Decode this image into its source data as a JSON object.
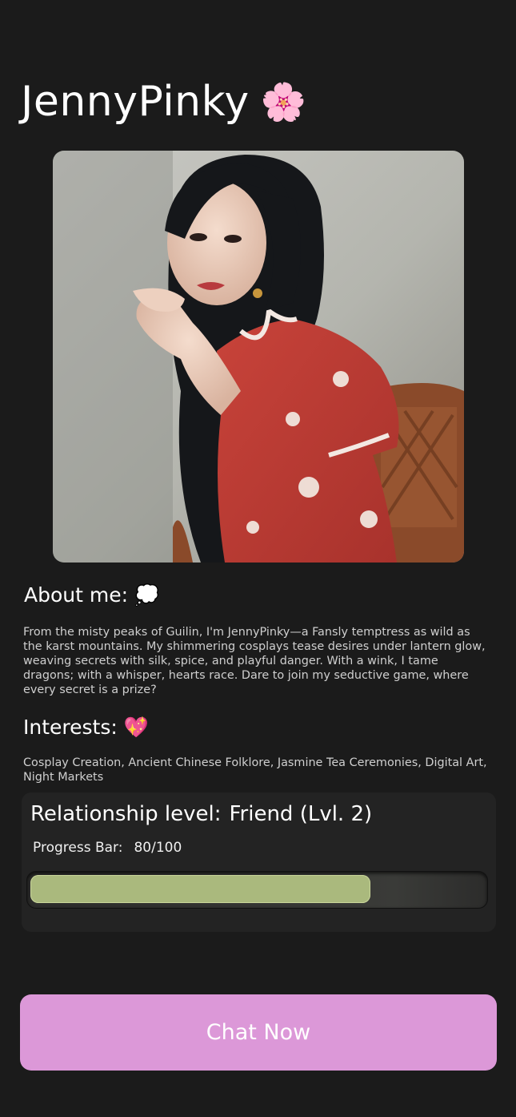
{
  "profile": {
    "name": "JennyPinky",
    "name_emoji": "🌸",
    "photo_alt": "Profile photo"
  },
  "about": {
    "heading": "About me:",
    "heading_emoji": "💭",
    "text": "From the misty peaks of Guilin, I'm JennyPinky—a Fansly temptress as wild as the karst mountains. My shimmering cosplays tease desires under lantern glow, weaving secrets with silk, spice, and playful danger. With a wink, I tame dragons; with a whisper, hearts race. Dare to join my seductive game, where every secret is a prize?"
  },
  "interests": {
    "heading": "Interests:",
    "heading_emoji": "💖",
    "text": "Cosplay Creation, Ancient Chinese Folklore, Jasmine Tea Ceremonies, Digital Art, Night Markets"
  },
  "relationship": {
    "label": "Relationship level:",
    "value": "Friend (Lvl. 2)",
    "progress_label": "Progress Bar:",
    "progress_text": "80/100",
    "progress_fraction": 0.75
  },
  "actions": {
    "chat_label": "Chat Now"
  },
  "colors": {
    "background": "#1b1b1b",
    "card": "#232323",
    "progress_fill": "#aab97d",
    "chat_button": "#dc98d8"
  }
}
